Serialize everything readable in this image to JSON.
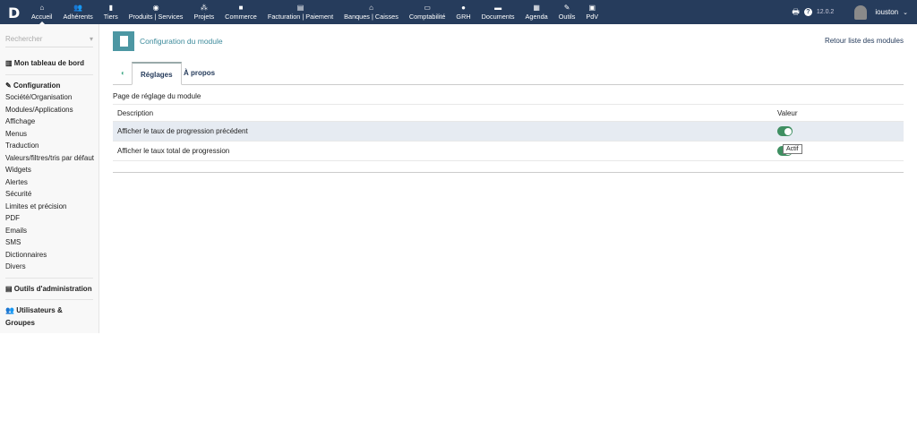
{
  "topbar": {
    "logo": "D",
    "menu": [
      {
        "label": "Accueil",
        "icon": "home-icon",
        "glyph": "⌂"
      },
      {
        "label": "Adhérents",
        "icon": "users-icon",
        "glyph": "👥"
      },
      {
        "label": "Tiers",
        "icon": "building-icon",
        "glyph": "▮"
      },
      {
        "label": "Produits | Services",
        "icon": "cube-icon",
        "glyph": "◉"
      },
      {
        "label": "Projets",
        "icon": "sitemap-icon",
        "glyph": "⁂"
      },
      {
        "label": "Commerce",
        "icon": "briefcase-icon",
        "glyph": "■"
      },
      {
        "label": "Facturation | Paiement",
        "icon": "invoice-icon",
        "glyph": "▤"
      },
      {
        "label": "Banques | Caisses",
        "icon": "bank-icon",
        "glyph": "⌂"
      },
      {
        "label": "Comptabilité",
        "icon": "ledger-icon",
        "glyph": "▭"
      },
      {
        "label": "GRH",
        "icon": "user-tie-icon",
        "glyph": "●"
      },
      {
        "label": "Documents",
        "icon": "folder-icon",
        "glyph": "▬"
      },
      {
        "label": "Agenda",
        "icon": "calendar-icon",
        "glyph": "▦"
      },
      {
        "label": "Outils",
        "icon": "wrench-icon",
        "glyph": "✎"
      },
      {
        "label": "PdV",
        "icon": "cash-register-icon",
        "glyph": "▣"
      }
    ],
    "version": "12.0.2",
    "user": "iouston"
  },
  "sidebar": {
    "search_placeholder": "Rechercher",
    "dashboard": "Mon tableau de bord",
    "config": "Configuration",
    "items": [
      "Société/Organisation",
      "Modules/Applications",
      "Affichage",
      "Menus",
      "Traduction",
      "Valeurs/filtres/tris par défaut",
      "Widgets",
      "Alertes",
      "Sécurité",
      "Limites et précision",
      "PDF",
      "Emails",
      "SMS",
      "Dictionnaires",
      "Divers"
    ],
    "admin_tools": "Outils d'administration",
    "users_groups": "Utilisateurs & Groupes"
  },
  "main": {
    "title": "Configuration du module",
    "back_link": "Retour liste des modules",
    "tabs": [
      "Réglages",
      "À propos"
    ],
    "section": "Page de réglage du module",
    "columns": [
      "Description",
      "Valeur"
    ],
    "rows": [
      {
        "label": "Afficher le taux de progression précédent",
        "value": "on"
      },
      {
        "label": "Afficher le taux total de progression",
        "value": "on"
      }
    ],
    "tooltip": "Actif"
  },
  "colors": {
    "topbar": "#263c5c",
    "toggle_on": "#3f8f62",
    "accent": "#4d97a3"
  }
}
